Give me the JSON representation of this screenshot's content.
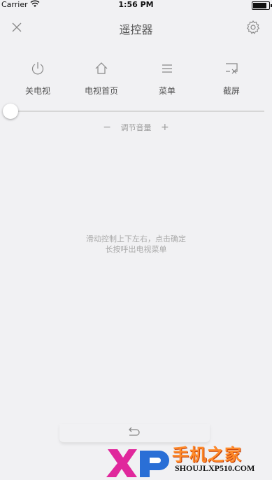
{
  "status_bar": {
    "carrier": "Carrier",
    "time": "1:56 PM"
  },
  "navbar": {
    "title": "遥控器",
    "close_icon": "close-icon",
    "settings_icon": "gear-icon"
  },
  "shortcuts": [
    {
      "label": "关电视",
      "icon": "power-icon"
    },
    {
      "label": "电视首页",
      "icon": "home-icon"
    },
    {
      "label": "菜单",
      "icon": "menu-icon"
    },
    {
      "label": "截屏",
      "icon": "screenshot-icon"
    }
  ],
  "slider": {
    "value_fraction": 0.0
  },
  "volume": {
    "minus": "−",
    "label": "调节音量",
    "plus": "+"
  },
  "touchpad": {
    "hint_line1": "滑动控制上下左右，点击确定",
    "hint_line2": "长按呼出电视菜单"
  },
  "back": {
    "icon": "back-icon"
  },
  "watermark": {
    "brand": "XP",
    "site_name": "手机之家",
    "url": "SHOUJLXP510.COM"
  },
  "colors": {
    "background": "#f1f1f3",
    "watermark_orange": "#ff8a2a",
    "watermark_magenta": "#e0289c",
    "watermark_blue": "#2a6fd6"
  }
}
